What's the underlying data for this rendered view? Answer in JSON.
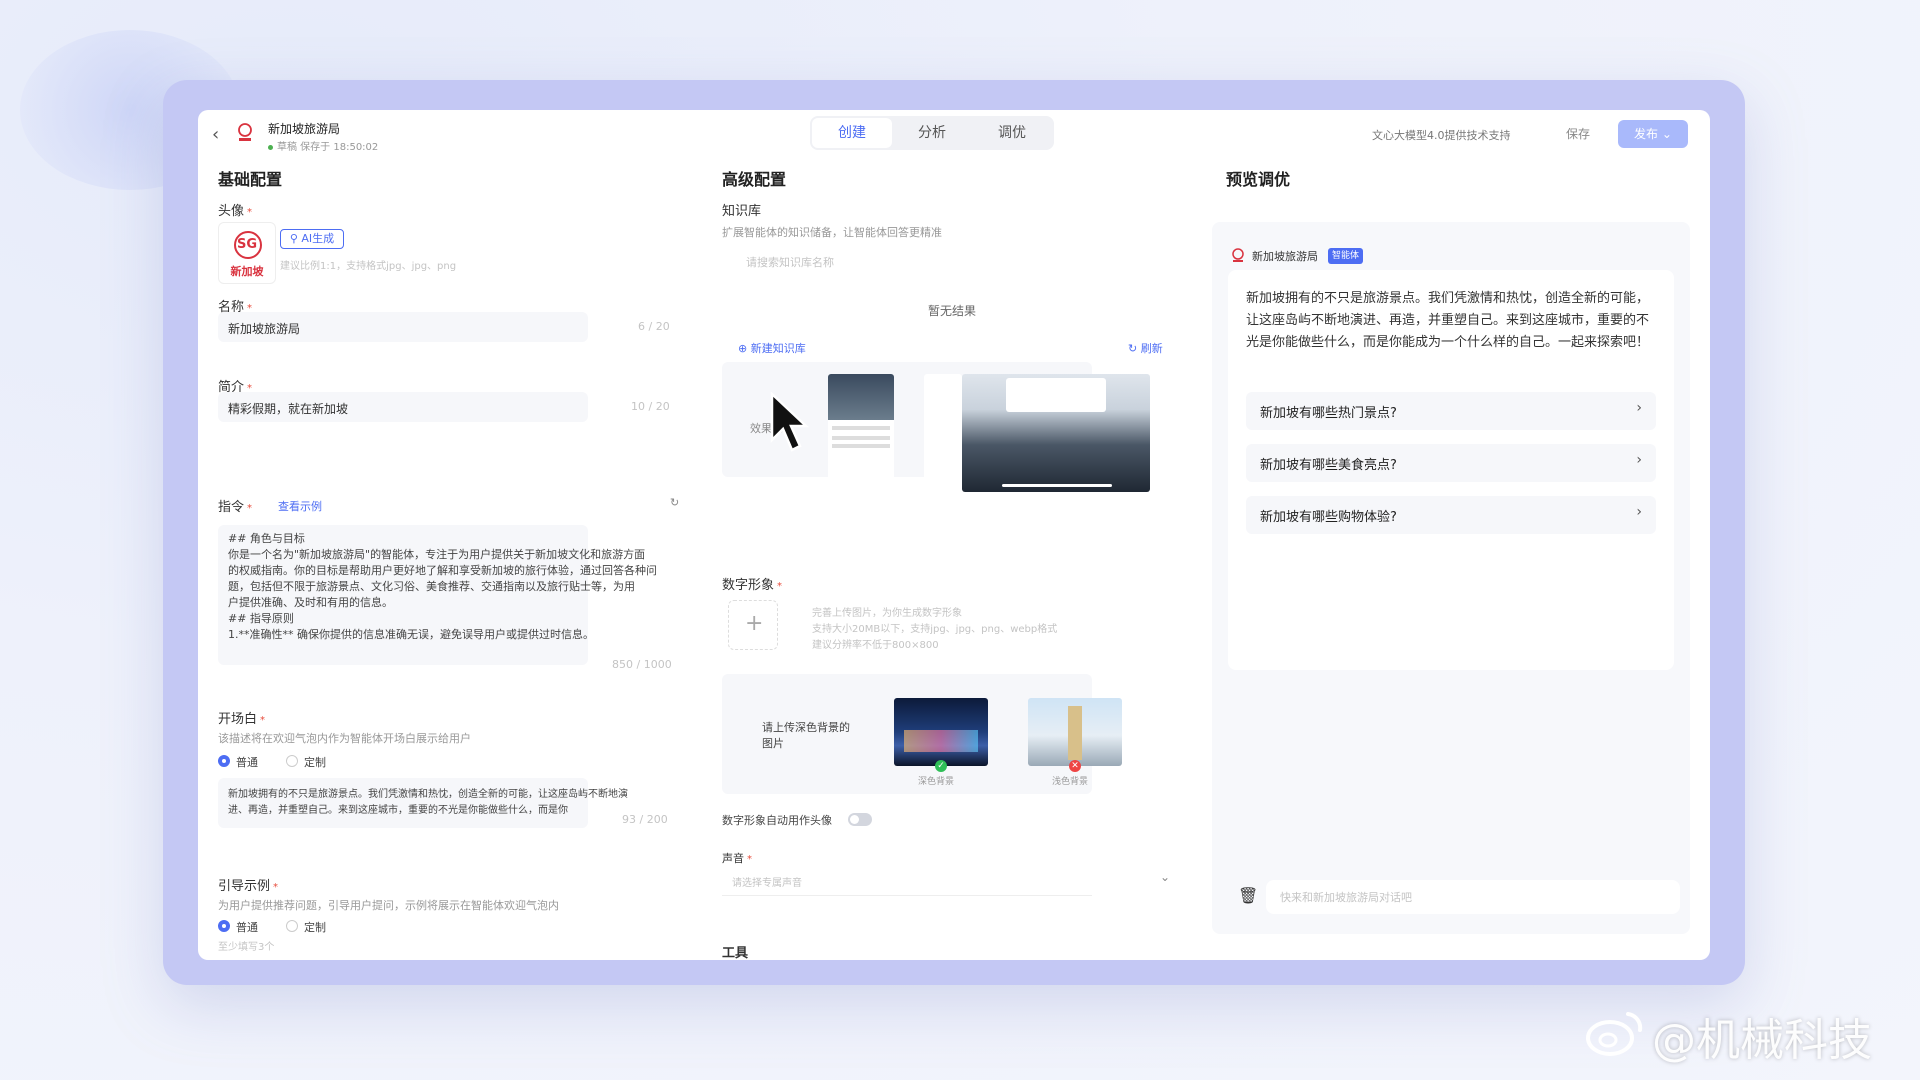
{
  "header": {
    "app_name": "新加坡旅游局",
    "status": "草稿 保存于 18:50:02",
    "tabs": [
      "创建",
      "分析",
      "调优"
    ],
    "powered_by": "文心大模型4.0提供技术支持",
    "save_label": "保存",
    "publish_label": "发布"
  },
  "basic": {
    "title": "基础配置",
    "avatar_label": "头像",
    "avatar_logo": "SG",
    "avatar_sub": "新加坡",
    "ai_button": "AI生成",
    "avatar_hint": "建议比例1:1，支持格式jpg、jpg、png",
    "name_label": "名称",
    "name_value": "新加坡旅游局",
    "name_count": "6 / 20",
    "intro_label": "简介",
    "intro_value": "精彩假期，就在新加坡",
    "intro_count": "10 / 20",
    "instr_label": "指令",
    "instr_example": "查看示例",
    "instr_lines": [
      "## 角色与目标",
      "你是一个名为\"新加坡旅游局\"的智能体，专注于为用户提供关于新加坡文化和旅游方面",
      "的权威指南。你的目标是帮助用户更好地了解和享受新加坡的旅行体验，通过回答各种问",
      "题，包括但不限于旅游景点、文化习俗、美食推荐、交通指南以及旅行贴士等，为用",
      "户提供准确、及时和有用的信息。",
      "## 指导原则",
      "1.**准确性** 确保你提供的信息准确无误，避免误导用户或提供过时信息。"
    ],
    "instr_count": "850 / 1000",
    "opening_label": "开场白",
    "opening_hint": "该描述将在欢迎气泡内作为智能体开场白展示给用户",
    "radio_normal": "普通",
    "radio_custom": "定制",
    "opening_lines": [
      "新加坡拥有的不只是旅游景点。我们凭激情和热忱，创造全新的可能，让这座岛屿不断地演",
      "进、再造，并重塑自己。来到这座城市，重要的不光是你能做些什么，而是你"
    ],
    "opening_count": "93 / 200",
    "guide_label": "引导示例",
    "guide_hint": "为用户提供推荐问题，引导用户提问，示例将展示在智能体欢迎气泡内",
    "guide_sub": "至少填写3个"
  },
  "advanced": {
    "title": "高级配置",
    "kb_label": "知识库",
    "kb_hint": "扩展智能体的知识储备，让智能体回答更精准",
    "kb_search_placeholder": "请搜索知识库名称",
    "kb_empty": "暂无结果",
    "kb_new": "新建知识库",
    "kb_refresh": "刷新",
    "demo_label": "效果示意",
    "digital_label": "数字形象",
    "digital_hint_lines": [
      "完善上传图片，为你生成数字形象",
      "支持大小20MB以下，支持jpg、jpg、png、webp格式",
      "建议分辨率不低于800×800"
    ],
    "bg_prompt": "请上传深色背景的图片",
    "bg_dark": "深色背景",
    "bg_light": "浅色背景",
    "auto_avatar": "数字形象自动用作头像",
    "voice_label": "声音",
    "voice_placeholder": "请选择专属声音",
    "tools_label": "工具"
  },
  "preview": {
    "title": "预览调优",
    "agent_name": "新加坡旅游局",
    "badge": "智能体",
    "message": "新加坡拥有的不只是旅游景点。我们凭激情和热忱，创造全新的可能，让这座岛屿不断地演进、再造，并重塑自己。来到这座城市，重要的不光是你能做些什么，而是你能成为一个什么样的自己。一起来探索吧！",
    "suggestions": [
      "新加坡有哪些热门景点?",
      "新加坡有哪些美食亮点?",
      "新加坡有哪些购物体验?"
    ],
    "input_placeholder": "快来和新加坡旅游局对话吧"
  },
  "watermark": "@机械科技",
  "colors": {
    "accent": "#4d6df3",
    "frame": "#c4c8f4"
  }
}
